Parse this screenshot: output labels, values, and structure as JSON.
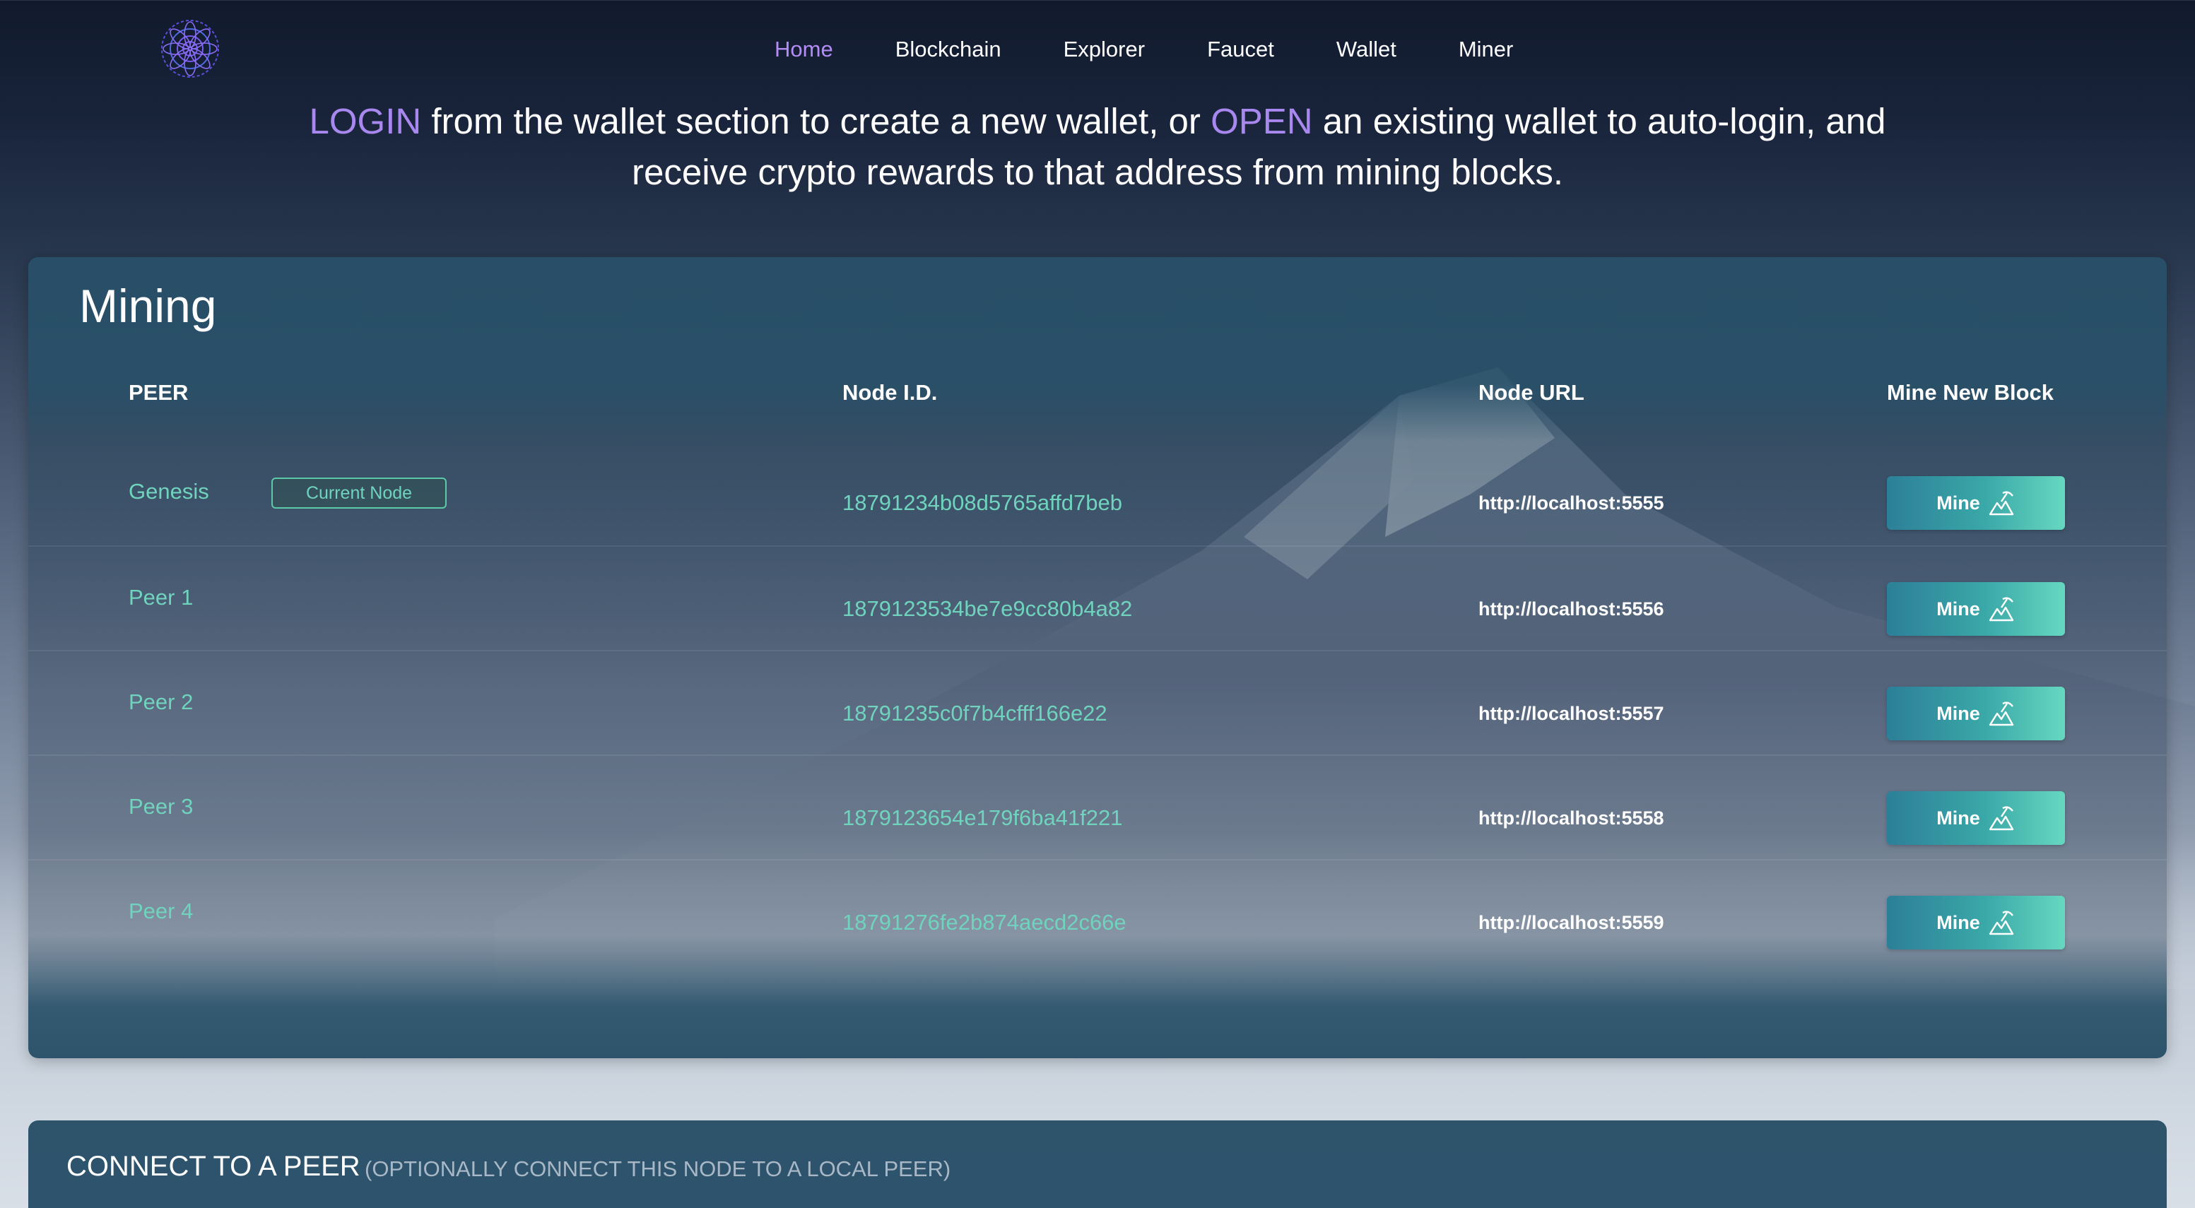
{
  "nav": {
    "items": [
      {
        "label": "Home",
        "active": true
      },
      {
        "label": "Blockchain",
        "active": false
      },
      {
        "label": "Explorer",
        "active": false
      },
      {
        "label": "Faucet",
        "active": false
      },
      {
        "label": "Wallet",
        "active": false
      },
      {
        "label": "Miner",
        "active": false
      }
    ]
  },
  "banner": {
    "login": "LOGIN",
    "part1": " from the wallet section to create a new wallet, or ",
    "open": "OPEN",
    "part2": " an existing wallet to auto-login, and",
    "line2": "receive crypto rewards to that address from mining blocks."
  },
  "mining": {
    "title": "Mining",
    "headers": {
      "peer": "PEER",
      "node_id": "Node I.D.",
      "node_url": "Node URL",
      "mine": "Mine New Block"
    },
    "rows": [
      {
        "peer": "Genesis",
        "badge": "Current Node",
        "node_id": "18791234b08d5765affd7beb",
        "url": "http://localhost:5555",
        "button": "Mine"
      },
      {
        "peer": "Peer 1",
        "node_id": "1879123534be7e9cc80b4a82",
        "url": "http://localhost:5556",
        "button": "Mine"
      },
      {
        "peer": "Peer 2",
        "node_id": "18791235c0f7b4cfff166e22",
        "url": "http://localhost:5557",
        "button": "Mine"
      },
      {
        "peer": "Peer 3",
        "node_id": "1879123654e179f6ba41f221",
        "url": "http://localhost:5558",
        "button": "Mine"
      },
      {
        "peer": "Peer 4",
        "node_id": "18791276fe2b874aecd2c66e",
        "url": "http://localhost:5559",
        "button": "Mine"
      }
    ]
  },
  "connect": {
    "title": "CONNECT TO A PEER",
    "subtitle": "(OPTIONALLY CONNECT THIS NODE TO A LOCAL PEER)"
  },
  "colors": {
    "accent_purple": "#b48cf5",
    "accent_teal": "#6fd3bd",
    "panel": "#285068"
  },
  "icons": {
    "logo": "mandala-logo-icon",
    "mine": "pickaxe-mountain-icon"
  }
}
